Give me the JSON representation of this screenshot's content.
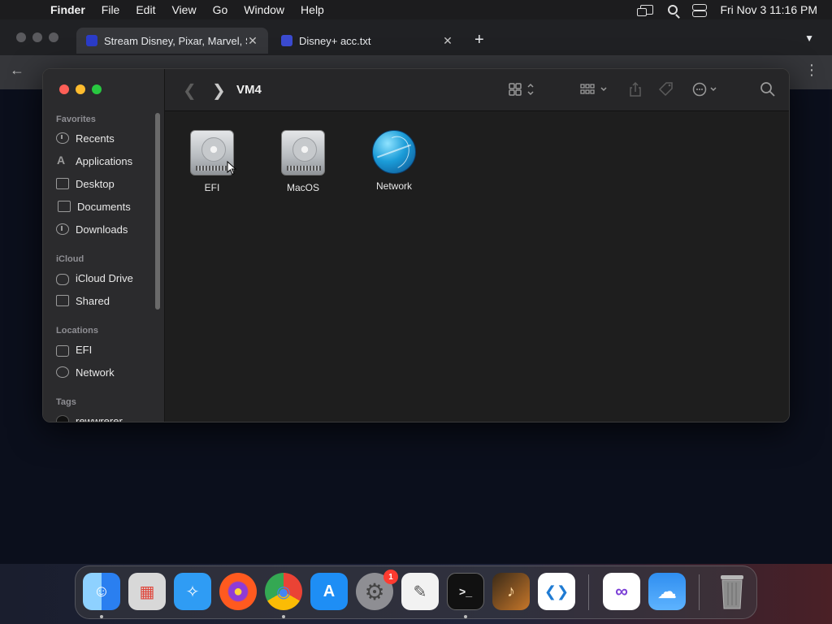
{
  "menubar": {
    "apple": "",
    "app": "Finder",
    "items": [
      "File",
      "Edit",
      "View",
      "Go",
      "Window",
      "Help"
    ],
    "clock": "Fri Nov 3  11:16 PM"
  },
  "browser": {
    "tabs": [
      {
        "title": "Stream Disney, Pixar, Marvel, S",
        "favicon_color": "#2b3cc9"
      },
      {
        "title": "Disney+ acc.txt",
        "favicon_color": "#3b4bd1"
      }
    ],
    "new_tab": "+",
    "close": "✕"
  },
  "finder": {
    "title": "VM4",
    "sidebar": {
      "favorites_label": "Favorites",
      "favorites": [
        "Recents",
        "Applications",
        "Desktop",
        "Documents",
        "Downloads"
      ],
      "icloud_label": "iCloud",
      "icloud": [
        "iCloud Drive",
        "Shared"
      ],
      "locations_label": "Locations",
      "locations": [
        "EFI",
        "Network"
      ],
      "tags_label": "Tags",
      "tags": [
        "rewwrerer"
      ]
    },
    "items": [
      {
        "label": "EFI",
        "icon": "drive-icon"
      },
      {
        "label": "MacOS",
        "icon": "drive-icon"
      },
      {
        "label": "Network",
        "icon": "globe-icon"
      }
    ]
  },
  "dock": {
    "apps": [
      {
        "name": "finder-app",
        "color": "#2a8cf0",
        "glyph": "☺"
      },
      {
        "name": "launchpad-app",
        "color": "#d6d6d6",
        "glyph": "▦"
      },
      {
        "name": "safari-app",
        "color": "#2f9cf4",
        "glyph": "✧"
      },
      {
        "name": "firefox-app",
        "color": "#ff7a1a",
        "glyph": "●"
      },
      {
        "name": "chrome-app",
        "color": "#e8e8e8",
        "glyph": "◉"
      },
      {
        "name": "app-store-app",
        "color": "#1e8ef5",
        "glyph": "A"
      },
      {
        "name": "system-settings-app",
        "color": "#8e8e93",
        "glyph": "⚙"
      },
      {
        "name": "textedit-app",
        "color": "#f2f2f2",
        "glyph": "✎"
      },
      {
        "name": "terminal-app",
        "color": "#111111",
        "glyph": ">_"
      },
      {
        "name": "garageband-app",
        "color": "#2a1e12",
        "glyph": "♪"
      },
      {
        "name": "vscode-app",
        "color": "#ffffff",
        "glyph": "❮❯"
      },
      {
        "name": "visual-studio-app",
        "color": "#ffffff",
        "glyph": "∞"
      },
      {
        "name": "weather-app",
        "color": "#2f8ef0",
        "glyph": "☁"
      },
      {
        "name": "trash-app",
        "color": "#9a9a9a",
        "glyph": "🗑"
      }
    ],
    "settings_badge": "1"
  }
}
